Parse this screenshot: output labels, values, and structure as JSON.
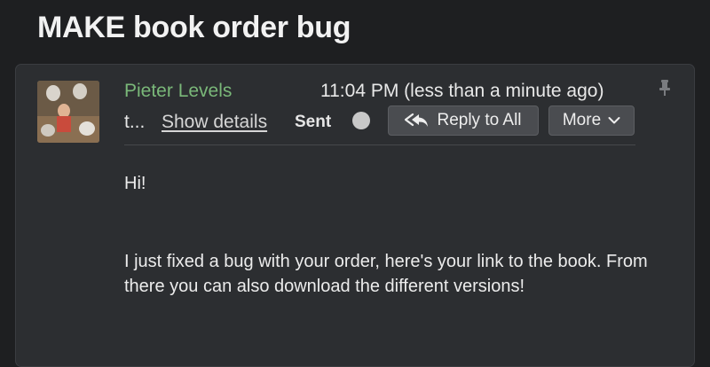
{
  "email": {
    "subject": "MAKE book order bug",
    "sender_name": "Pieter Levels",
    "time": "11:04 PM (less than a minute ago)",
    "recipient_truncated": "t...",
    "show_details_label": "Show details",
    "status_label": "Sent",
    "reply_all_label": "Reply to All",
    "more_label": "More",
    "greeting": "Hi!",
    "message": "I just fixed a bug with your order, here's your link to the book. From there you can also download the different versions!"
  },
  "icons": {
    "avatar": "avatar-photo",
    "pin": "pin-icon",
    "status": "status-dot-icon",
    "reply_all": "reply-all-icon",
    "more": "chevron-down-icon"
  },
  "colors": {
    "background": "#1e1f21",
    "panel": "#2c2e31",
    "sender": "#7ab879",
    "button": "#4a4c50"
  }
}
